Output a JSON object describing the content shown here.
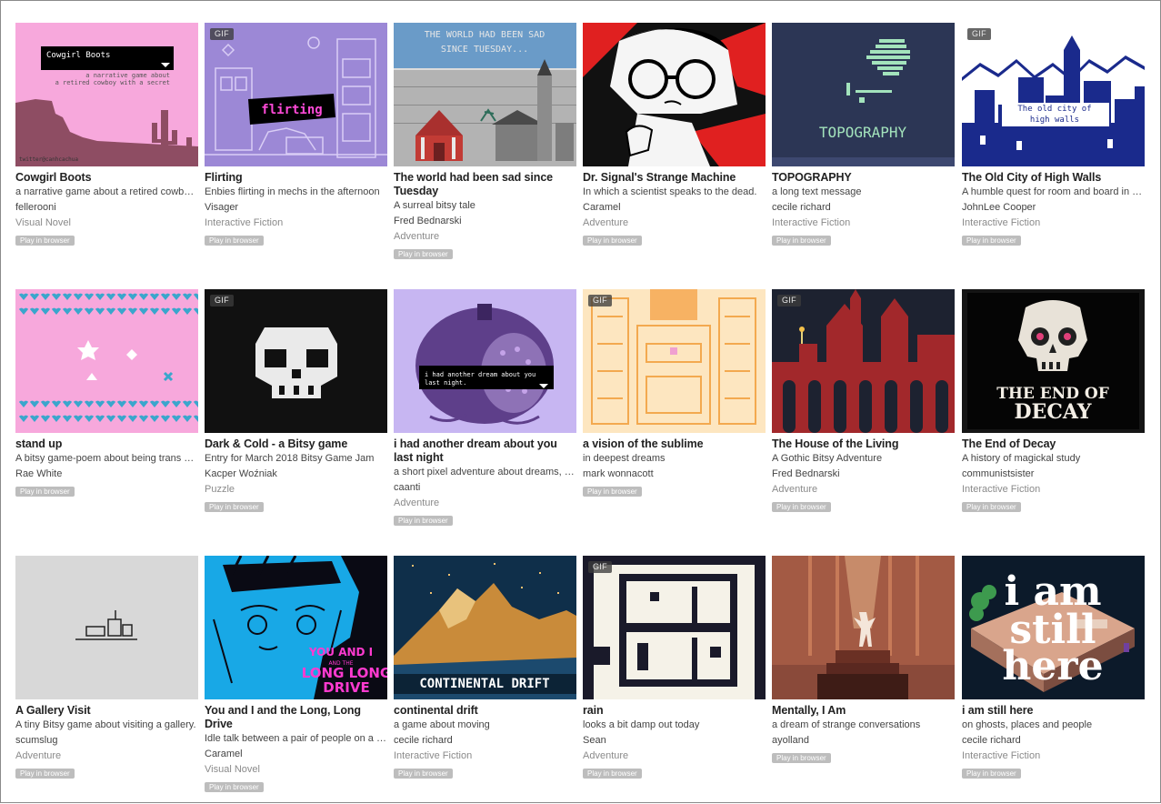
{
  "gif_label": "GIF",
  "games": [
    {
      "title": "Cowgirl Boots",
      "desc": "a narrative game about a retired cowboy with a secret",
      "author": "fellerooni",
      "genre": "Visual Novel",
      "play": "Play in browser",
      "gif": false,
      "thumb_text": [
        "Cowgirl Boots",
        "a narrative game about",
        "a retired cowboy with a secret",
        "twitter@canhcachua"
      ]
    },
    {
      "title": "Flirting",
      "desc": "Enbies flirting in mechs in the afternoon",
      "author": "Visager",
      "genre": "Interactive Fiction",
      "play": "Play in browser",
      "gif": true,
      "thumb_text": [
        "flirting"
      ]
    },
    {
      "title": "The world had been sad since Tuesday",
      "desc": "A surreal bitsy tale",
      "author": "Fred Bednarski",
      "genre": "Adventure",
      "play": "Play in browser",
      "gif": false,
      "thumb_text": [
        "THE WORLD HAD BEEN SAD",
        "SINCE TUESDAY..."
      ]
    },
    {
      "title": "Dr. Signal's Strange Machine",
      "desc": "In which a scientist speaks to the dead.",
      "author": "Caramel",
      "genre": "Adventure",
      "play": "Play in browser",
      "gif": false,
      "thumb_text": []
    },
    {
      "title": "TOPOGRAPHY",
      "desc": "a long text message",
      "author": "cecile richard",
      "genre": "Interactive Fiction",
      "play": "Play in browser",
      "gif": false,
      "thumb_text": [
        "TOPOGRAPHY"
      ]
    },
    {
      "title": "The Old City of High Walls",
      "desc": "A humble quest for room and board in a walled city",
      "author": "JohnLee Cooper",
      "genre": "Interactive Fiction",
      "play": "Play in browser",
      "gif": true,
      "thumb_text": [
        "The old city of",
        "high walls"
      ]
    },
    {
      "title": "stand up",
      "desc": "A bitsy game-poem about being trans and sad",
      "author": "Rae White",
      "genre": "",
      "play": "Play in browser",
      "gif": false,
      "thumb_text": []
    },
    {
      "title": "Dark & Cold - a Bitsy game",
      "desc": "Entry for March 2018 Bitsy Game Jam",
      "author": "Kacper Woźniak",
      "genre": "Puzzle",
      "play": "Play in browser",
      "gif": true,
      "thumb_text": []
    },
    {
      "title": "i had another dream about you last night",
      "desc": "a short pixel adventure about dreams, crushes",
      "author": "caanti",
      "genre": "Adventure",
      "play": "Play in browser",
      "gif": false,
      "thumb_text": [
        "i had another dream about you",
        "last night."
      ]
    },
    {
      "title": "a vision of the sublime",
      "desc": "in deepest dreams",
      "author": "mark wonnacott",
      "genre": "",
      "play": "Play in browser",
      "gif": true,
      "thumb_text": []
    },
    {
      "title": "The House of the Living",
      "desc": "A Gothic Bitsy Adventure",
      "author": "Fred Bednarski",
      "genre": "Adventure",
      "play": "Play in browser",
      "gif": true,
      "thumb_text": []
    },
    {
      "title": "The End of Decay",
      "desc": "A history of magickal study",
      "author": "communistsister",
      "genre": "Interactive Fiction",
      "play": "Play in browser",
      "gif": false,
      "thumb_text": [
        "THE END OF",
        "DECAY"
      ]
    },
    {
      "title": "A Gallery Visit",
      "desc": "A tiny Bitsy game about visiting a gallery.",
      "author": "scumslug",
      "genre": "Adventure",
      "play": "Play in browser",
      "gif": false,
      "thumb_text": []
    },
    {
      "title": "You and I and the Long, Long Drive",
      "desc": "Idle talk between a pair of people on a road trip",
      "author": "Caramel",
      "genre": "Visual Novel",
      "play": "Play in browser",
      "gif": false,
      "thumb_text": [
        "YOU AND I",
        "AND THE",
        "LONG LONG",
        "DRIVE"
      ]
    },
    {
      "title": "continental drift",
      "desc": "a game about moving",
      "author": "cecile richard",
      "genre": "Interactive Fiction",
      "play": "Play in browser",
      "gif": false,
      "thumb_text": [
        "CONTINENTAL DRIFT"
      ]
    },
    {
      "title": "rain",
      "desc": "looks a bit damp out today",
      "author": "Sean",
      "genre": "Adventure",
      "play": "Play in browser",
      "gif": true,
      "thumb_text": []
    },
    {
      "title": "Mentally, I Am",
      "desc": "a dream of strange conversations",
      "author": "ayolland",
      "genre": "",
      "play": "Play in browser",
      "gif": false,
      "thumb_text": []
    },
    {
      "title": "i am still here",
      "desc": "on ghosts, places and people",
      "author": "cecile richard",
      "genre": "Interactive Fiction",
      "play": "Play in browser",
      "gif": false,
      "thumb_text": [
        "i am",
        "still",
        "here"
      ]
    }
  ]
}
